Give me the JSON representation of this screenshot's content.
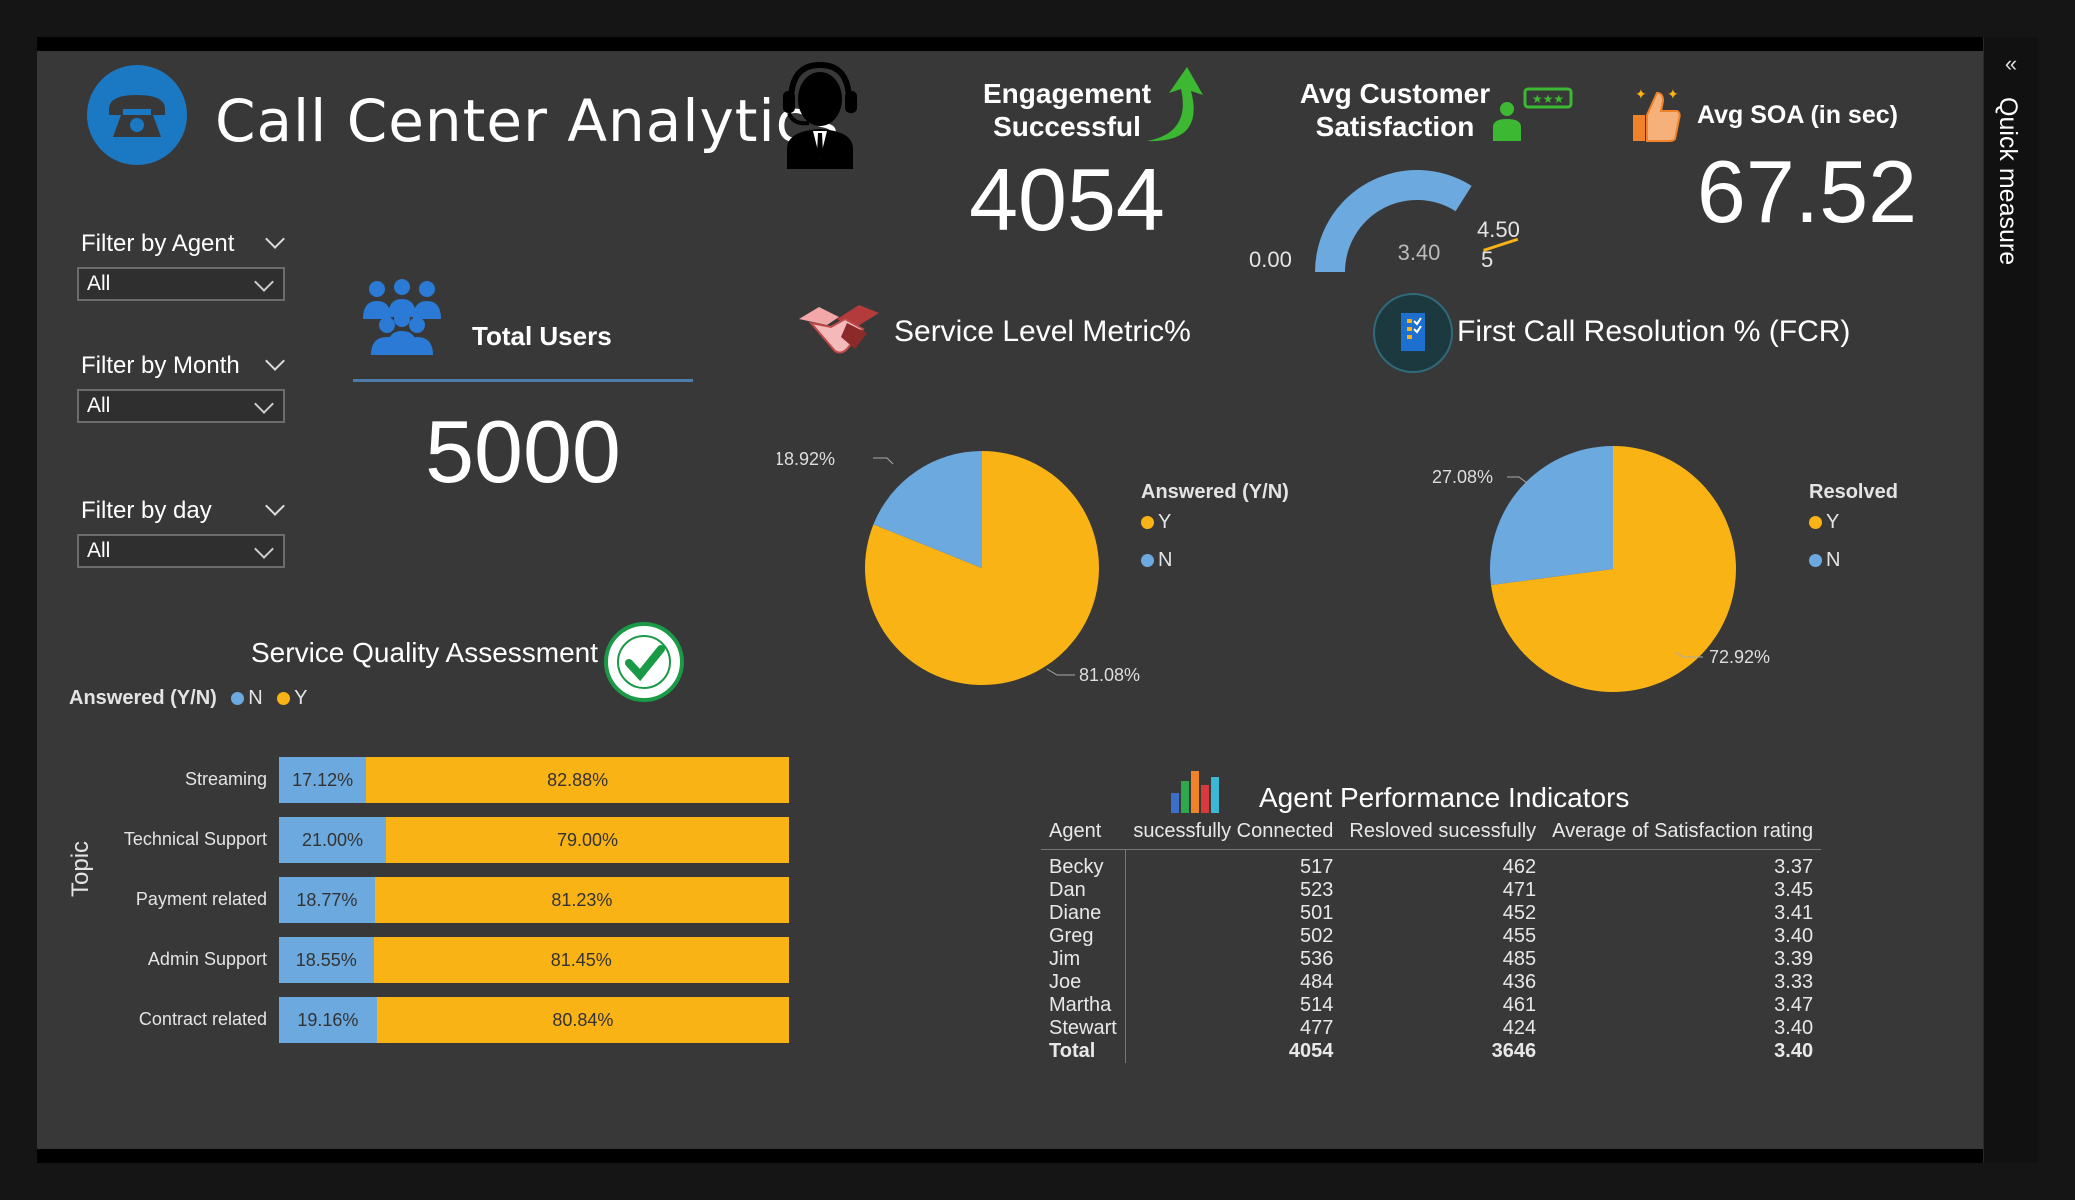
{
  "header": {
    "title": "Call Center Analytics"
  },
  "kpis": {
    "engagement_label_1": "Engagement",
    "engagement_label_2": "Successful",
    "engagement_value": "4054",
    "csat_label_1": "Avg Customer",
    "csat_label_2": "Satisfaction",
    "csat_min": "0.00",
    "csat_value": "3.40",
    "csat_target": "4.50",
    "csat_max": "5",
    "csat_fraction": 0.68,
    "csat_target_fraction": 0.9,
    "soa_label": "Avg SOA (in sec)",
    "soa_value": "67.52",
    "users_label": "Total Users",
    "users_value": "5000"
  },
  "filters": [
    {
      "label": "Filter by Agent",
      "value": "All"
    },
    {
      "label": "Filter by Month",
      "value": "All"
    },
    {
      "label": "Filter by day",
      "value": "All"
    }
  ],
  "quick_measure": {
    "label": "Quick measure",
    "chevron": "«"
  },
  "service_level": {
    "title": "Service Level Metric%",
    "legend_title": "Answered (Y/N)",
    "legend": [
      "Y",
      "N"
    ]
  },
  "fcr": {
    "title": "First Call Resolution % (FCR)",
    "legend_title": "Resolved",
    "legend": [
      "Y",
      "N"
    ]
  },
  "sqa": {
    "title": "Service Quality Assessment",
    "legend_title": "Answered (Y/N)",
    "legend": [
      "N",
      "Y"
    ],
    "axis_label": "Topic"
  },
  "perf": {
    "title": "Agent Performance Indicators",
    "columns": [
      "Agent",
      "sucessfully Connected",
      "Resloved sucessfully",
      "Average of Satisfaction rating"
    ],
    "rows": [
      [
        "Becky",
        "517",
        "462",
        "3.37"
      ],
      [
        "Dan",
        "523",
        "471",
        "3.45"
      ],
      [
        "Diane",
        "501",
        "452",
        "3.41"
      ],
      [
        "Greg",
        "502",
        "455",
        "3.40"
      ],
      [
        "Jim",
        "536",
        "485",
        "3.39"
      ],
      [
        "Joe",
        "484",
        "436",
        "3.33"
      ],
      [
        "Martha",
        "514",
        "461",
        "3.47"
      ],
      [
        "Stewart",
        "477",
        "424",
        "3.40"
      ]
    ],
    "total": [
      "Total",
      "4054",
      "3646",
      "3.40"
    ]
  },
  "chart_data": [
    {
      "type": "pie",
      "title": "Service Level Metric%",
      "legend_title": "Answered (Y/N)",
      "labels": [
        "Y",
        "N"
      ],
      "values": [
        81.08,
        18.92
      ],
      "value_labels": [
        "81.08%",
        "18.92%"
      ],
      "colors": [
        "#f9b315",
        "#6ca9de"
      ]
    },
    {
      "type": "pie",
      "title": "First Call Resolution % (FCR)",
      "legend_title": "Resolved",
      "labels": [
        "Y",
        "N"
      ],
      "values": [
        72.92,
        27.08
      ],
      "value_labels": [
        "72.92%",
        "27.08%"
      ],
      "colors": [
        "#f9b315",
        "#6ca9de"
      ]
    },
    {
      "type": "bar",
      "title": "Service Quality Assessment",
      "orientation": "horizontal",
      "stacked": "100%",
      "ylabel": "Topic",
      "categories": [
        "Streaming",
        "Technical Support",
        "Payment related",
        "Admin Support",
        "Contract related"
      ],
      "series": [
        {
          "name": "N",
          "color": "#6ca9de",
          "values": [
            17.12,
            21.0,
            18.77,
            18.55,
            19.16
          ],
          "labels": [
            "17.12%",
            "21.00%",
            "18.77%",
            "18.55%",
            "19.16%"
          ]
        },
        {
          "name": "Y",
          "color": "#f9b315",
          "values": [
            82.88,
            79.0,
            81.23,
            81.45,
            80.84
          ],
          "labels": [
            "82.88%",
            "79.00%",
            "81.23%",
            "81.45%",
            "80.84%"
          ]
        }
      ]
    }
  ],
  "colors": {
    "yes": "#f9b315",
    "no": "#6ca9de",
    "background": "#383838",
    "gauge": "#6ca9de",
    "target": "#f9b315"
  }
}
